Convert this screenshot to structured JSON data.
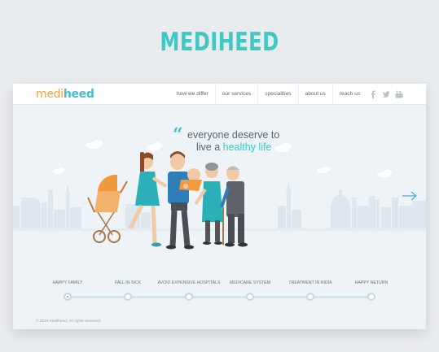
{
  "brand_title": "MEDIHEED",
  "logo": {
    "part1": "medi",
    "part2": "heed"
  },
  "nav": {
    "items": [
      {
        "label": "how we differ"
      },
      {
        "label": "our services"
      },
      {
        "label": "specialities"
      },
      {
        "label": "about us"
      },
      {
        "label": "reach us"
      }
    ],
    "social_icons": [
      "facebook-icon",
      "twitter-icon",
      "youtube-icon"
    ]
  },
  "hero": {
    "quote_mark": "“",
    "tagline_line1": "everyone deserve to",
    "tagline_line2_prefix": "live a ",
    "tagline_line2_highlight": "healthy life"
  },
  "timeline": {
    "steps": [
      {
        "label": "HAPPY FAMILY",
        "active": true
      },
      {
        "label": "FALL IN SICK",
        "active": false
      },
      {
        "label": "AVOID EXPENSIVE HOSPITALS",
        "active": false
      },
      {
        "label": "MEDICARE SYSTEM",
        "active": false
      },
      {
        "label": "TREATMENT IN INDIA",
        "active": false
      },
      {
        "label": "HAPPY RETURN",
        "active": false
      }
    ]
  },
  "footer": {
    "copyright": "© 2015 Mediheed. All rights reserved."
  },
  "colors": {
    "accent": "#3fc9c1",
    "logo_orange": "#f5a33c",
    "active_dot": "#4aaed9"
  }
}
